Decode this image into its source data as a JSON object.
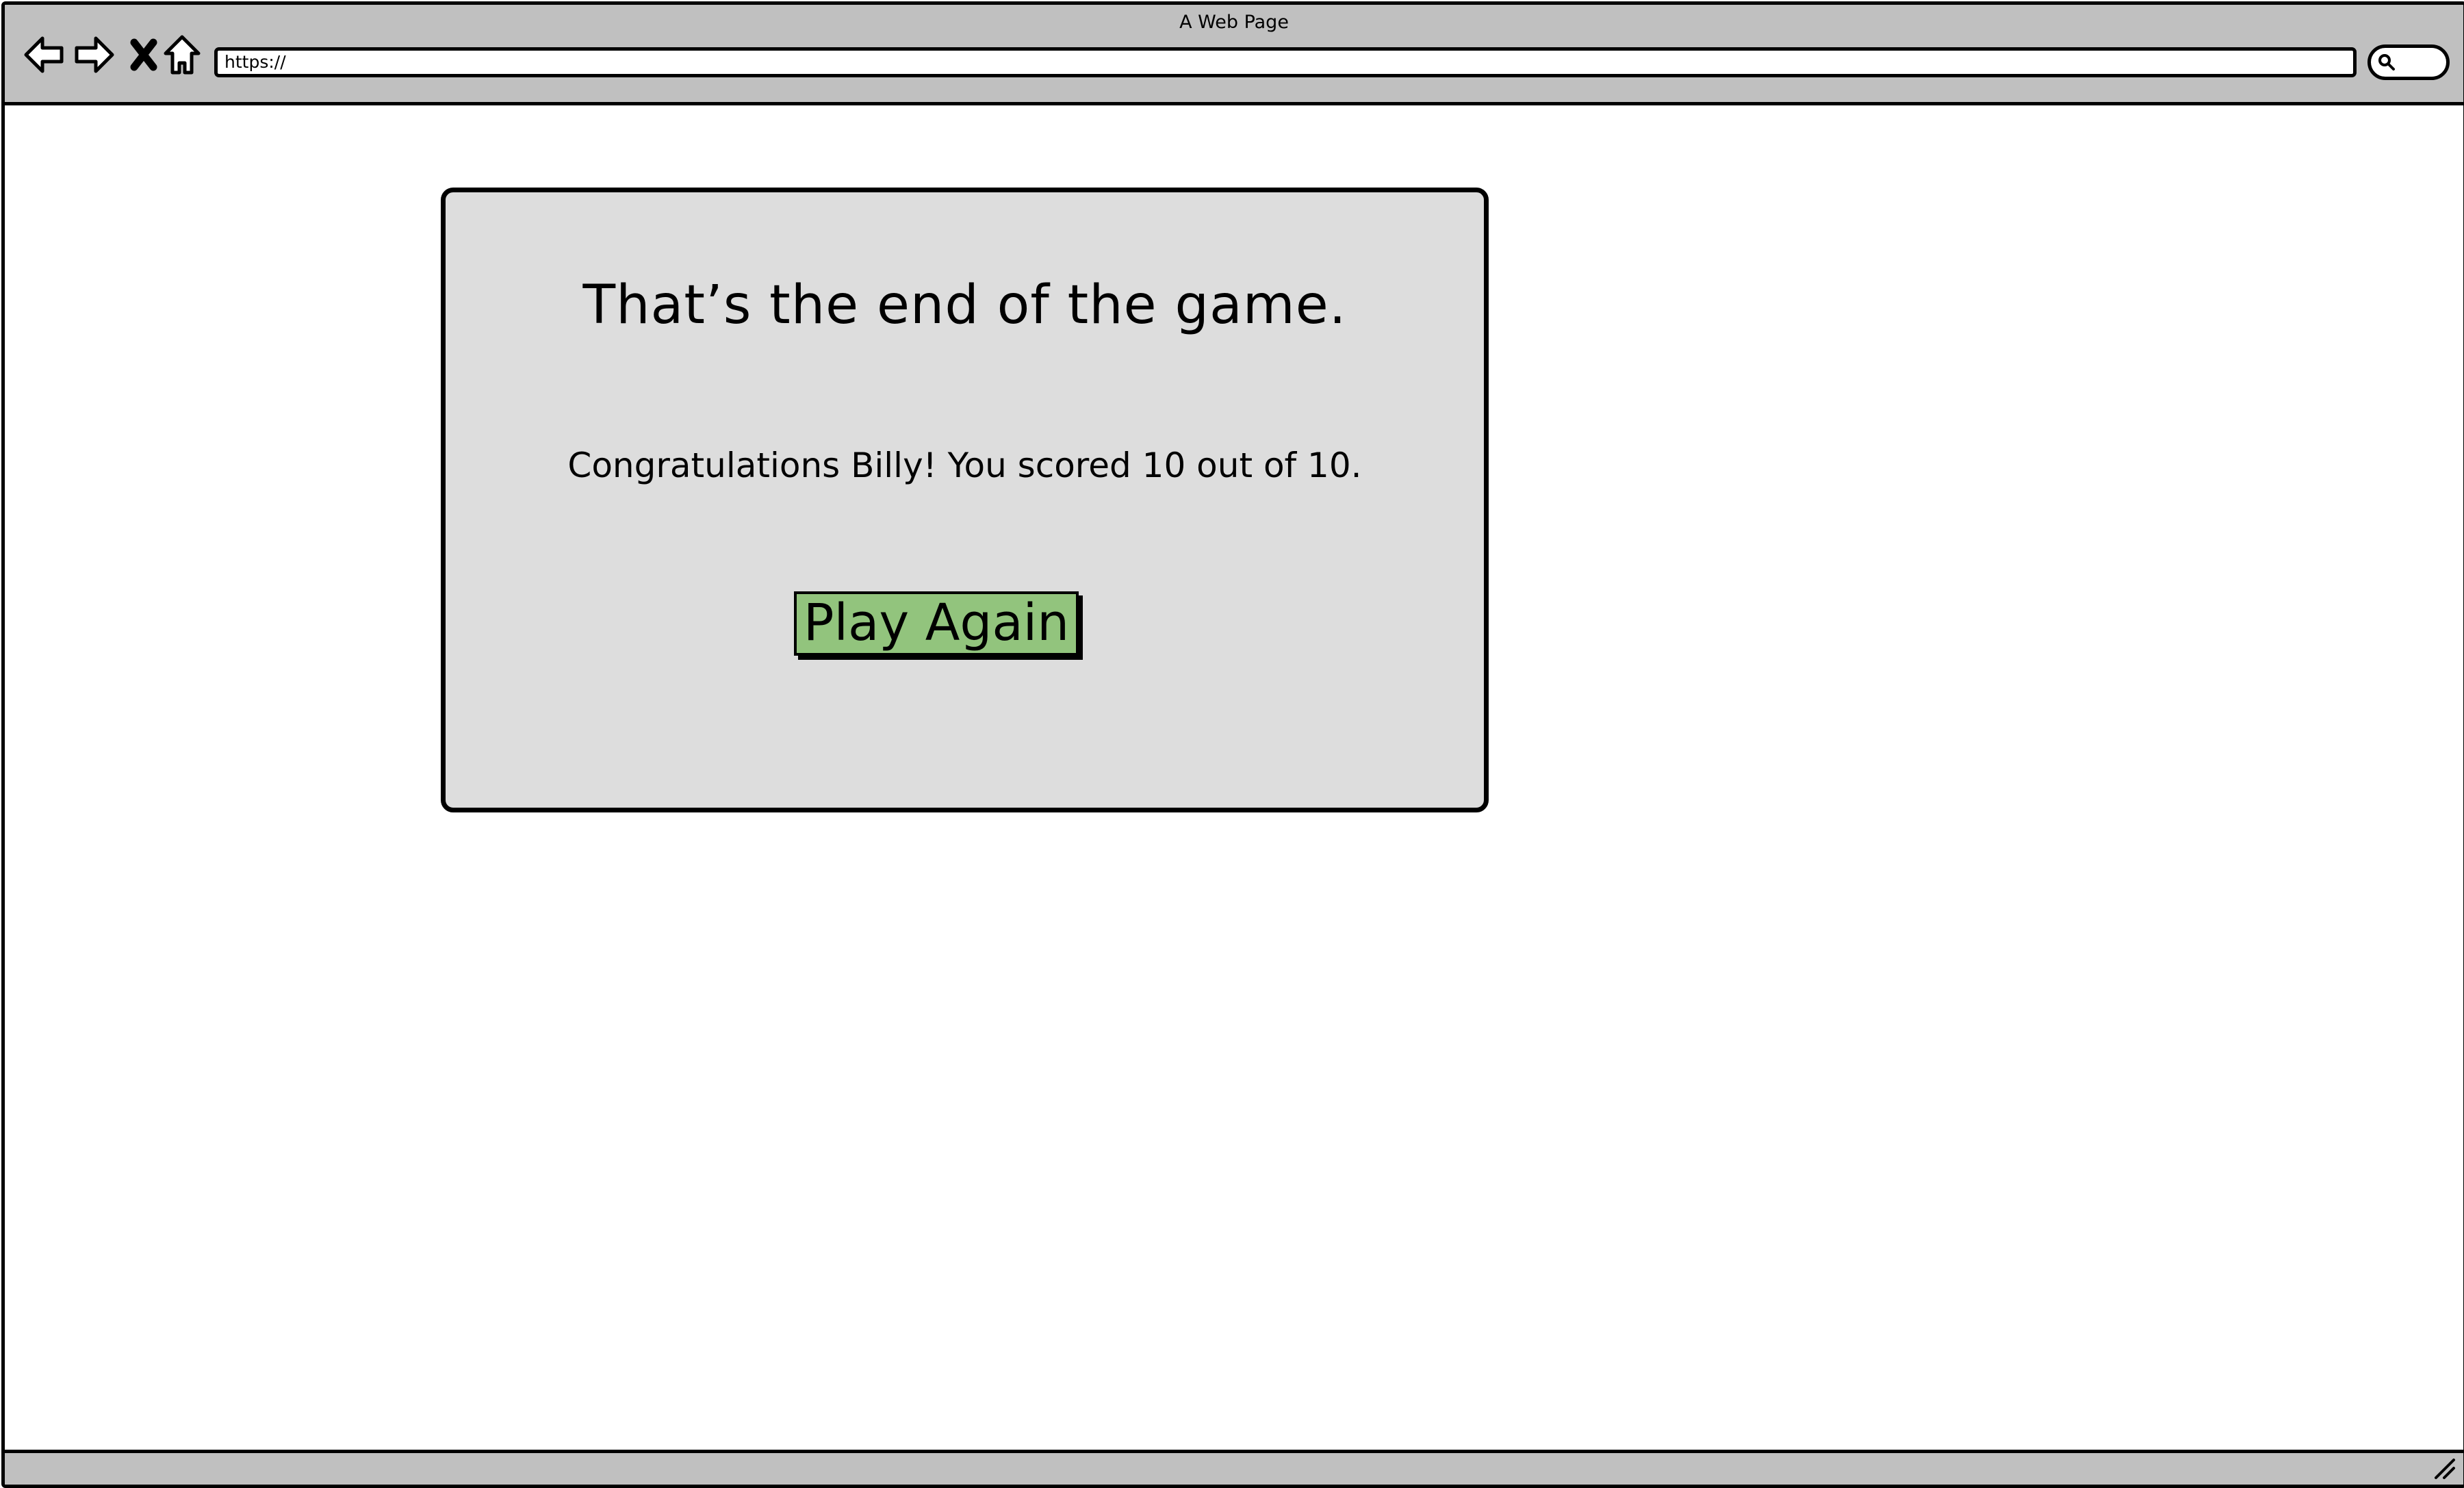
{
  "window": {
    "title": "A Web Page"
  },
  "toolbar": {
    "back_icon": "back-arrow-icon",
    "forward_icon": "forward-arrow-icon",
    "stop_icon": "close-icon",
    "home_icon": "home-icon",
    "search_icon": "search-icon"
  },
  "address_bar": {
    "value": "https://"
  },
  "dialog": {
    "title": "That’s the end of the game.",
    "message": "Congratulations Billy! You scored 10 out of 10.",
    "button_label": "Play Again"
  },
  "colors": {
    "chrome": "#c0c0c0",
    "dialog_background": "#dddddd",
    "button_green": "#92c47d",
    "border": "#000000"
  }
}
